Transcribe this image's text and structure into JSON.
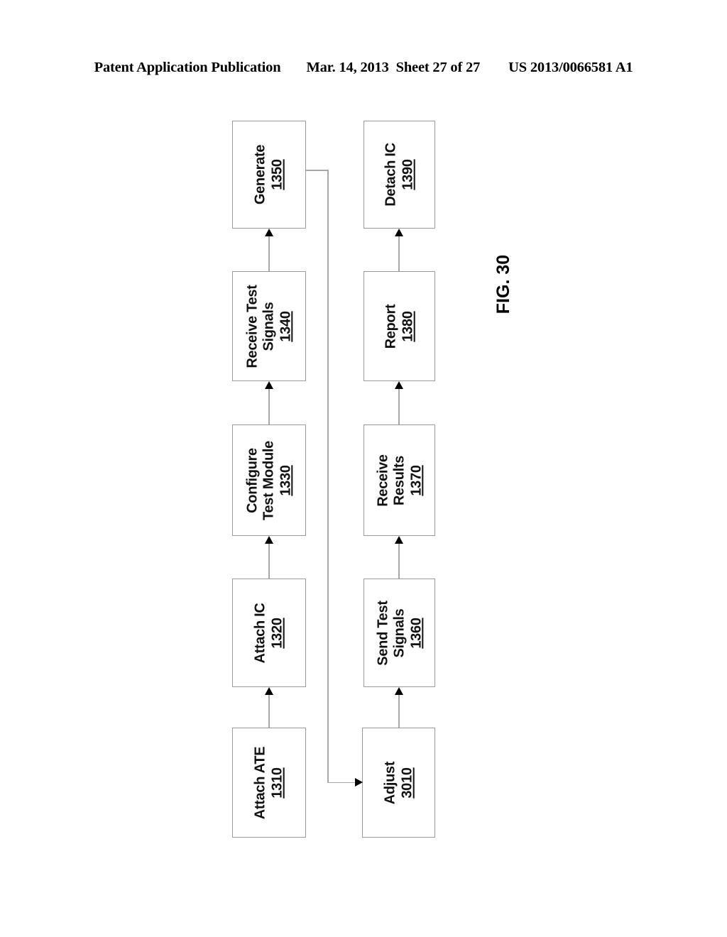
{
  "header": {
    "publication": "Patent Application Publication",
    "date": "Mar. 14, 2013",
    "sheet": "Sheet 27 of 27",
    "patent_number": "US 2013/0066581 A1"
  },
  "figure": {
    "caption": "FIG. 30"
  },
  "colors": {
    "box_border": "#9a9a9a",
    "connector": "#a8a8a8",
    "arrowhead": "#000000",
    "text": "#111111",
    "background": "#ffffff"
  },
  "flow": {
    "orientation": "rotated-90-ccw",
    "blocks": [
      {
        "id": "attach-ate",
        "label_line1": "Attach ATE",
        "label_line2": "",
        "ref": "1310",
        "column": "left",
        "row": 5
      },
      {
        "id": "attach-ic",
        "label_line1": "Attach IC",
        "label_line2": "",
        "ref": "1320",
        "column": "left",
        "row": 4
      },
      {
        "id": "configure-test-module",
        "label_line1": "Configure",
        "label_line2": "Test Module",
        "ref": "1330",
        "column": "left",
        "row": 3
      },
      {
        "id": "receive-test-signals",
        "label_line1": "Receive Test",
        "label_line2": "Signals",
        "ref": "1340",
        "column": "left",
        "row": 2
      },
      {
        "id": "generate",
        "label_line1": "Generate",
        "label_line2": "",
        "ref": "1350",
        "column": "left",
        "row": 1
      },
      {
        "id": "adjust",
        "label_line1": "Adjust",
        "label_line2": "",
        "ref": "3010",
        "column": "right",
        "row": 5
      },
      {
        "id": "send-test-signals",
        "label_line1": "Send Test",
        "label_line2": "Signals",
        "ref": "1360",
        "column": "right",
        "row": 4
      },
      {
        "id": "receive-results",
        "label_line1": "Receive",
        "label_line2": "Results",
        "ref": "1370",
        "column": "right",
        "row": 3
      },
      {
        "id": "report",
        "label_line1": "Report",
        "label_line2": "",
        "ref": "1380",
        "column": "right",
        "row": 2
      },
      {
        "id": "detach-ic",
        "label_line1": "Detach IC",
        "label_line2": "",
        "ref": "1390",
        "column": "right",
        "row": 1
      }
    ],
    "edges": [
      {
        "from": "attach-ate",
        "to": "attach-ic",
        "style": "straight"
      },
      {
        "from": "attach-ic",
        "to": "configure-test-module",
        "style": "straight"
      },
      {
        "from": "configure-test-module",
        "to": "receive-test-signals",
        "style": "straight"
      },
      {
        "from": "receive-test-signals",
        "to": "generate",
        "style": "straight"
      },
      {
        "from": "generate",
        "to": "adjust",
        "style": "elbow"
      },
      {
        "from": "adjust",
        "to": "send-test-signals",
        "style": "straight"
      },
      {
        "from": "send-test-signals",
        "to": "receive-results",
        "style": "straight"
      },
      {
        "from": "receive-results",
        "to": "report",
        "style": "straight"
      },
      {
        "from": "report",
        "to": "detach-ic",
        "style": "straight"
      }
    ]
  }
}
